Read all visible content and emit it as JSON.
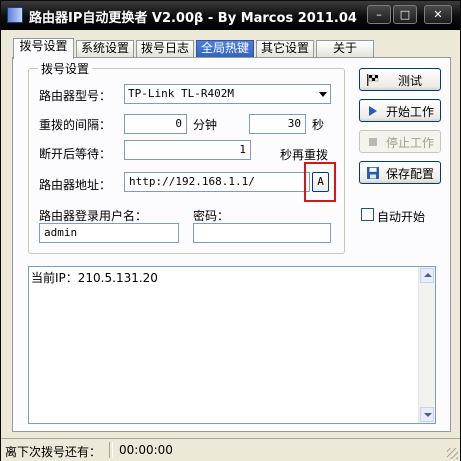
{
  "window": {
    "title": "路由器IP自动更换者 V2.00β - By Marcos 2011.04",
    "minimize_label": "–",
    "maximize_label": "□",
    "close_label": "✕"
  },
  "tabs": [
    {
      "label": "拨号设置",
      "active": true
    },
    {
      "label": "系统设置",
      "active": false
    },
    {
      "label": "拨号日志",
      "active": false
    },
    {
      "label": "全局热键",
      "active": false
    },
    {
      "label": "其它设置",
      "active": false
    },
    {
      "label": "关于",
      "active": false
    }
  ],
  "dial_settings": {
    "group_title": "拨号设置",
    "router_model_label": "路由器型号：",
    "router_model_value": "TP-Link TL-R402M",
    "interval_label": "重拨的间隔：",
    "interval_minutes": "0",
    "minutes_unit": "分钟",
    "interval_seconds": "30",
    "seconds_unit": "秒",
    "wait_label": "断开后等待：",
    "wait_value": "1",
    "wait_suffix": "秒再重拨",
    "address_label": "路由器地址：",
    "address_value": "http://192.168.1.1/",
    "address_button_label": "A",
    "username_label": "路由器登录用户名：",
    "username_value": "admin",
    "password_label": "密码：",
    "password_value": ""
  },
  "buttons": {
    "test": "测试",
    "start": "开始工作",
    "stop": "停止工作",
    "save": "保存配置"
  },
  "autostart": {
    "label": "自动开始",
    "checked": false
  },
  "log": {
    "text": "当前IP：210.5.131.20"
  },
  "statusbar": {
    "label": "离下次拨号还有：",
    "value": "00:00:00"
  },
  "colors": {
    "titlebar": "#000000",
    "highlight_tab": "#3a6ac9",
    "red_outline": "#d81616",
    "start_icon": "#1f5fbf"
  }
}
